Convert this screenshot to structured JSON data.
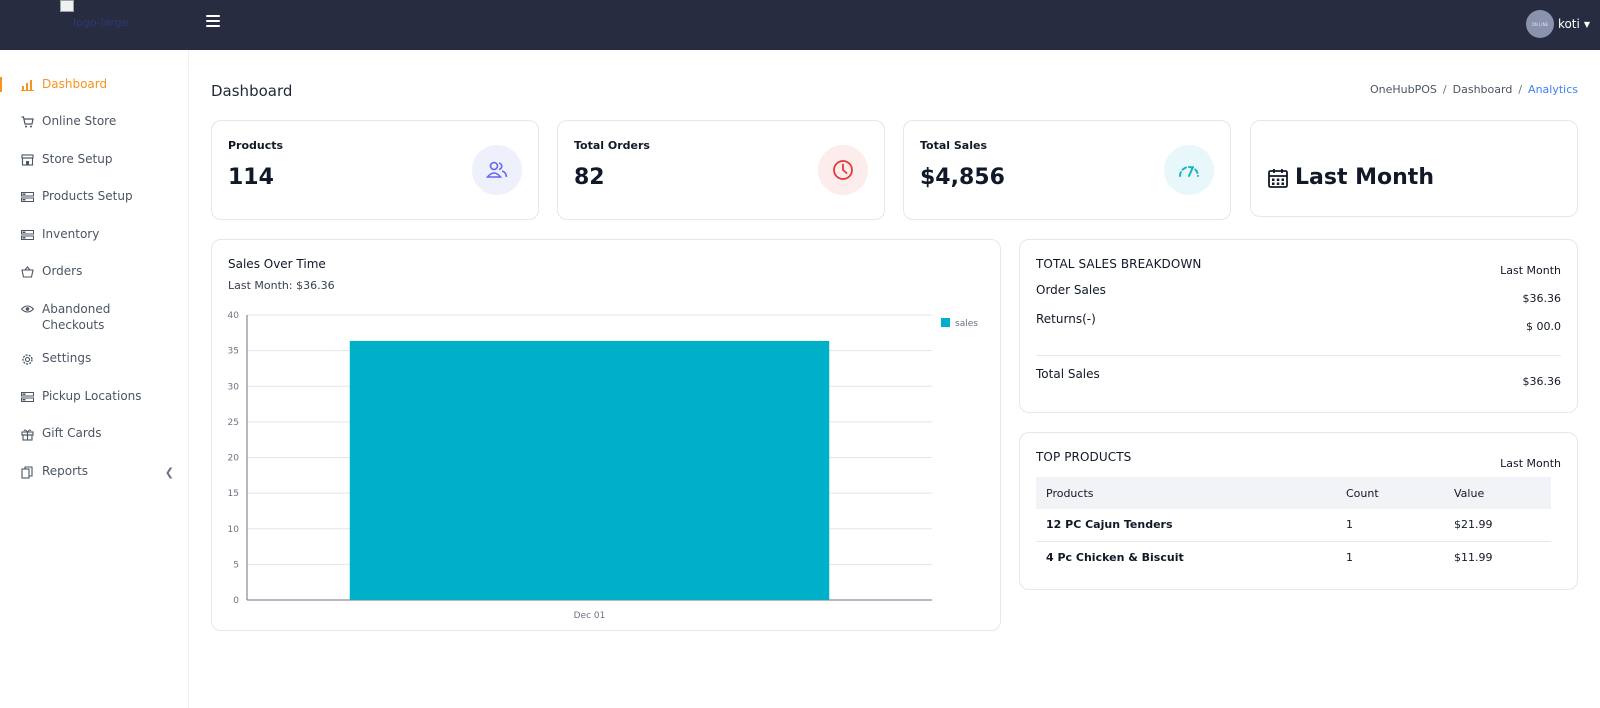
{
  "topbar": {
    "logo_alt": "logo-large",
    "user_name": "koti",
    "avatar_text": "ON LINE"
  },
  "sidebar": {
    "items": [
      {
        "label": "Dashboard",
        "icon": "bar-chart-icon",
        "active": true
      },
      {
        "label": "Online Store",
        "icon": "cart-icon"
      },
      {
        "label": "Store Setup",
        "icon": "store-icon"
      },
      {
        "label": "Products Setup",
        "icon": "list-icon"
      },
      {
        "label": "Inventory",
        "icon": "list-icon"
      },
      {
        "label": "Orders",
        "icon": "basket-icon"
      },
      {
        "label": "Abandoned Checkouts",
        "icon": "eye-icon"
      },
      {
        "label": "Settings",
        "icon": "gear-icon"
      },
      {
        "label": "Pickup Locations",
        "icon": "list-icon"
      },
      {
        "label": "Gift Cards",
        "icon": "gift-icon"
      },
      {
        "label": "Reports",
        "icon": "reports-icon"
      }
    ]
  },
  "page": {
    "title": "Dashboard",
    "breadcrumb": [
      "OneHubPOS",
      "Dashboard",
      "Analytics"
    ]
  },
  "stats": [
    {
      "label": "Products",
      "value": "114",
      "icon": "users-icon",
      "color": "#6366f1",
      "bg": "#eef0fb"
    },
    {
      "label": "Total Orders",
      "value": "82",
      "icon": "clock-icon",
      "color": "#e53935",
      "bg": "#fdecec"
    },
    {
      "label": "Total Sales",
      "value": "$4,856",
      "icon": "speedometer-icon",
      "color": "#17b3c9",
      "bg": "#e8f8fa"
    }
  ],
  "period_card": {
    "label": "Last Month",
    "icon": "calendar-icon"
  },
  "sales_chart": {
    "title": "Sales Over Time",
    "subtitle": "Last Month: $36.36"
  },
  "chart_data": {
    "type": "bar",
    "categories": [
      "Dec 01"
    ],
    "series": [
      {
        "name": "sales",
        "values": [
          36.36
        ],
        "color": "#00b0c8"
      }
    ],
    "ylim": [
      0,
      40
    ],
    "yticks": [
      0,
      5,
      10,
      15,
      20,
      25,
      30,
      35,
      40
    ],
    "grid": true,
    "legend": "top-right"
  },
  "breakdown": {
    "title": "TOTAL SALES BREAKDOWN",
    "period": "Last Month",
    "rows": [
      {
        "label": "Order Sales",
        "value": "$36.36"
      },
      {
        "label": "Returns(-)",
        "value": "$ 00.0"
      }
    ],
    "total": {
      "label": "Total Sales",
      "value": "$36.36"
    }
  },
  "top_products": {
    "title": "TOP PRODUCTS",
    "period": "Last Month",
    "columns": [
      "Products",
      "Count",
      "Value"
    ],
    "rows": [
      {
        "name": "12 PC Cajun Tenders",
        "count": "1",
        "value": "$21.99"
      },
      {
        "name": "4 Pc Chicken & Biscuit",
        "count": "1",
        "value": "$11.99"
      }
    ]
  },
  "colors": {
    "accent": "#f7931e",
    "topbar": "#282c40",
    "link": "#3b82f6"
  }
}
